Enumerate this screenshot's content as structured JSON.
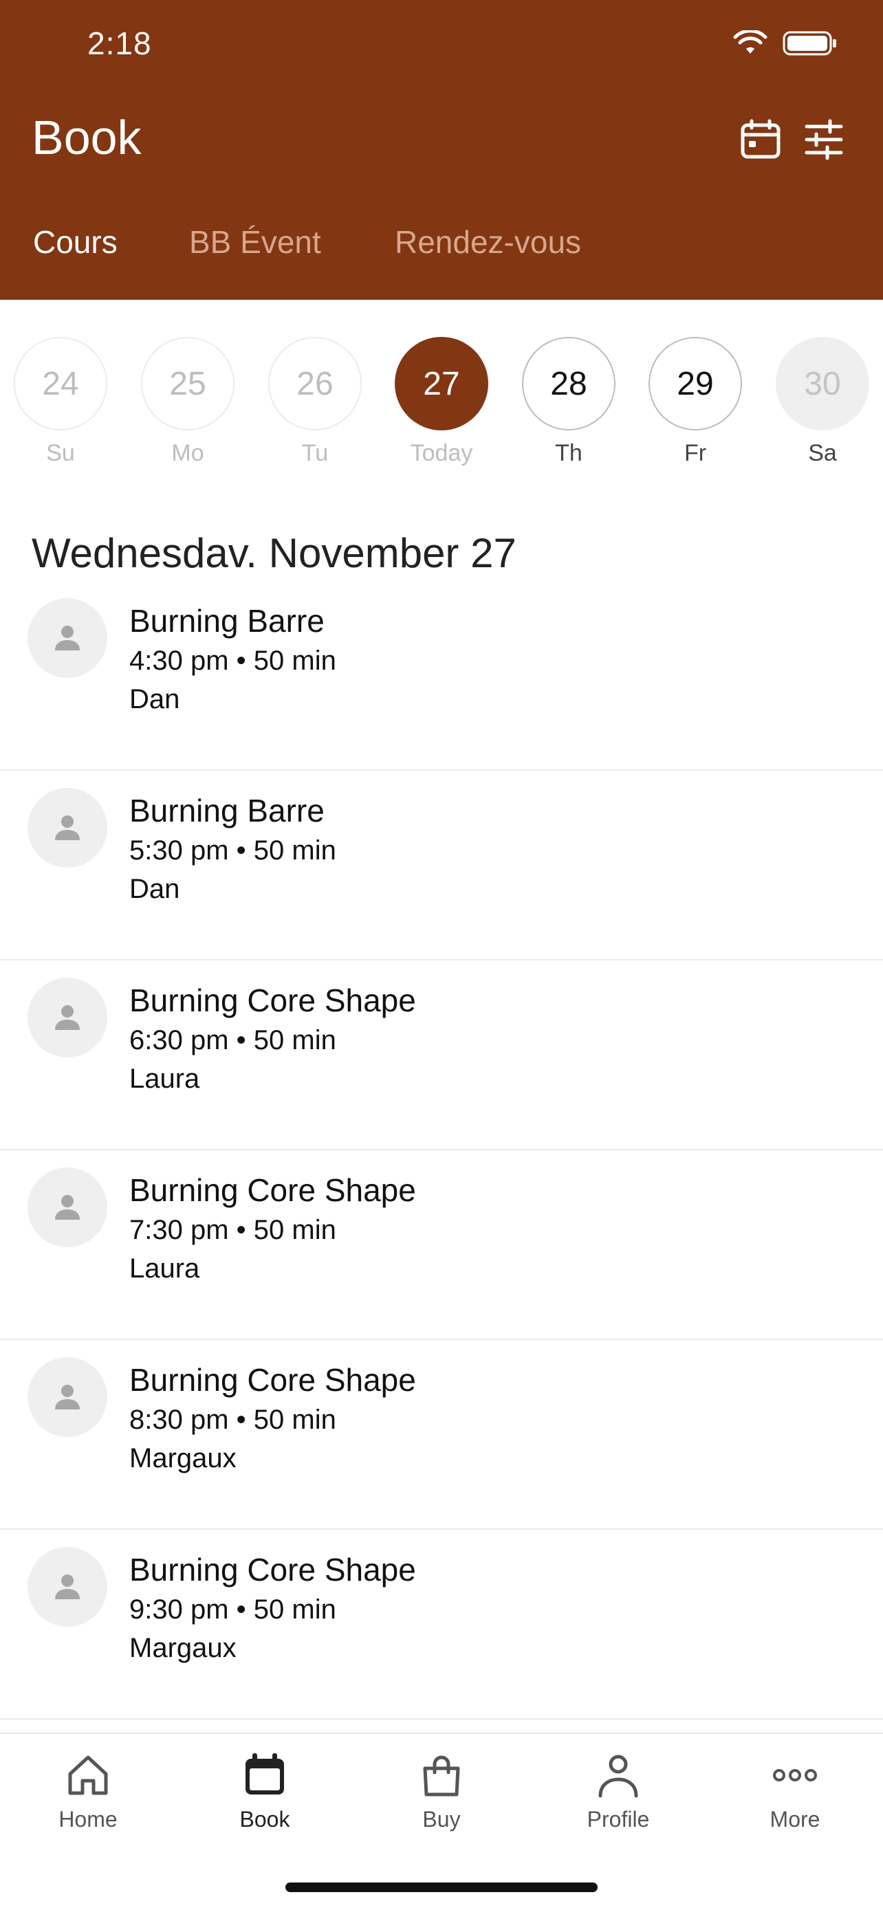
{
  "status_bar": {
    "time": "2:18"
  },
  "header": {
    "title": "Book",
    "icons": [
      "calendar-icon",
      "filter-sliders-icon"
    ],
    "background_color": "#823612"
  },
  "tabs": [
    {
      "label": "Cours",
      "active": true
    },
    {
      "label": "BB Évent",
      "active": false
    },
    {
      "label": "Rendez-vous",
      "active": false
    }
  ],
  "date_strip": [
    {
      "number": "24",
      "label": "Su",
      "state": "past"
    },
    {
      "number": "25",
      "label": "Mo",
      "state": "past"
    },
    {
      "number": "26",
      "label": "Tu",
      "state": "past"
    },
    {
      "number": "27",
      "label": "Today",
      "state": "selected"
    },
    {
      "number": "28",
      "label": "Th",
      "state": "available"
    },
    {
      "number": "29",
      "label": "Fr",
      "state": "available"
    },
    {
      "number": "30",
      "label": "Sa",
      "state": "unavailable"
    }
  ],
  "date_heading": "Wednesdav. November 27",
  "classes": [
    {
      "name": "Burning Barre",
      "time": "4:30 pm • 50 min",
      "instructor": "Dan"
    },
    {
      "name": "Burning Barre",
      "time": "5:30 pm • 50 min",
      "instructor": "Dan"
    },
    {
      "name": "Burning Core Shape",
      "time": "6:30 pm • 50 min",
      "instructor": "Laura"
    },
    {
      "name": "Burning Core Shape",
      "time": "7:30 pm • 50 min",
      "instructor": "Laura"
    },
    {
      "name": "Burning Core Shape",
      "time": "8:30 pm • 50 min",
      "instructor": "Margaux"
    },
    {
      "name": "Burning Core Shape",
      "time": "9:30 pm • 50 min",
      "instructor": "Margaux"
    }
  ],
  "bottom_nav": [
    {
      "label": "Home",
      "icon": "home-icon",
      "active": false
    },
    {
      "label": "Book",
      "icon": "calendar-icon",
      "active": true
    },
    {
      "label": "Buy",
      "icon": "shopping-bag-icon",
      "active": false
    },
    {
      "label": "Profile",
      "icon": "person-icon",
      "active": false
    },
    {
      "label": "More",
      "icon": "more-dots-icon",
      "active": false
    }
  ]
}
